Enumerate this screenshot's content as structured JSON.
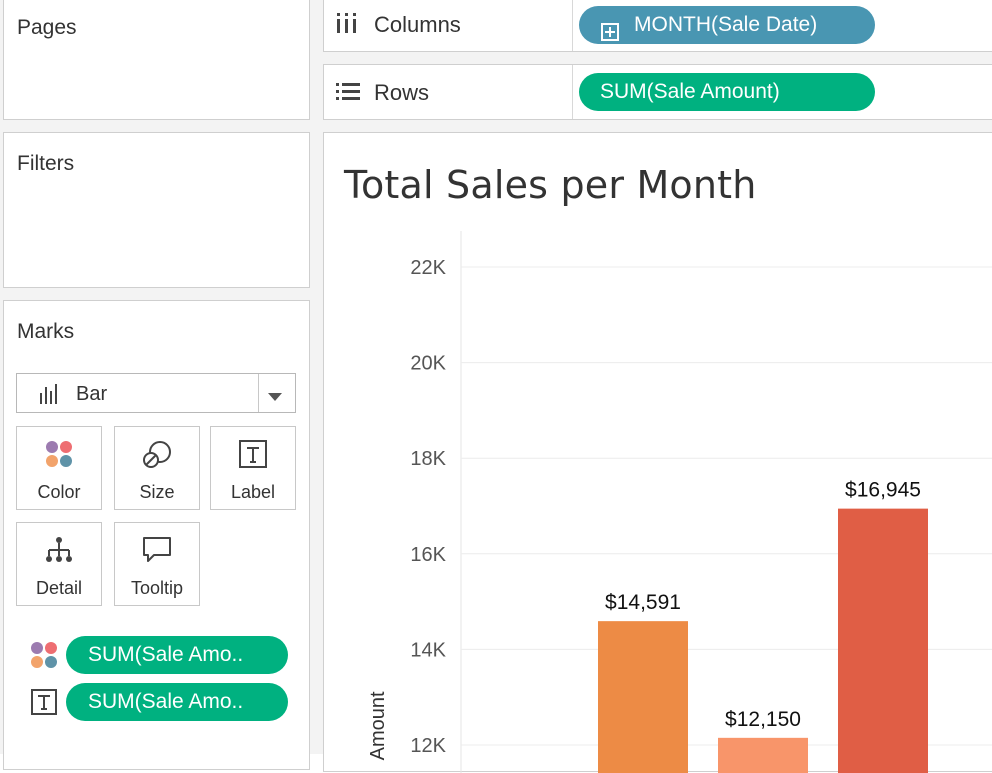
{
  "cards": {
    "pages_title": "Pages",
    "filters_title": "Filters",
    "marks_title": "Marks"
  },
  "shelves": {
    "columns": {
      "label": "Columns",
      "pill": "MONTH(Sale Date)",
      "icon": "columns-icon"
    },
    "rows": {
      "label": "Rows",
      "pill": "SUM(Sale Amount)",
      "icon": "rows-icon"
    }
  },
  "marks": {
    "mark_type": "Bar",
    "buttons": {
      "color": "Color",
      "size": "Size",
      "label": "Label",
      "detail": "Detail",
      "tooltip": "Tooltip"
    },
    "fields": [
      {
        "icon": "color-dots-icon",
        "pill": "SUM(Sale Amo.."
      },
      {
        "icon": "text-label-icon",
        "pill": "SUM(Sale Amo.."
      }
    ]
  },
  "colors": {
    "pill_blue": "#4996b2",
    "pill_green": "#00b180"
  },
  "chart_data": {
    "type": "bar",
    "title": "Total Sales per Month",
    "ylabel": "Amount",
    "ylim_visible": [
      12000,
      22000
    ],
    "y_ticks": [
      "12K",
      "14K",
      "16K",
      "18K",
      "20K",
      "22K"
    ],
    "y_tick_values": [
      12000,
      14000,
      16000,
      18000,
      20000,
      22000
    ],
    "grid": true,
    "values": [
      14591,
      12150,
      16945
    ],
    "data_labels": [
      "$14,591",
      "$12,150",
      "$16,945"
    ],
    "bar_colors": [
      "#ed8b45",
      "#f8956a",
      "#e05e45"
    ]
  }
}
